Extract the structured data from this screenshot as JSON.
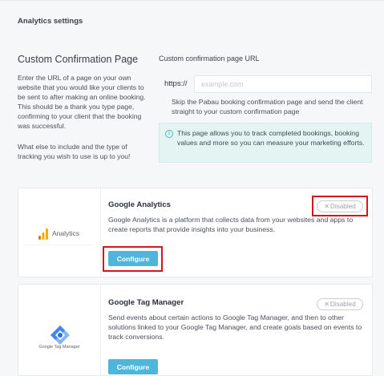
{
  "header": {
    "title": "Analytics settings"
  },
  "confirmation": {
    "heading": "Custom Confirmation Page",
    "description": "Enter the URL of a page on your own website that you would like your clients to be sent to after making an online booking. This should be a thank you type page, confirming to your client that the booking was successful.",
    "description_more": "What else to include and the type of tracking you wish to use is up to you!",
    "url_label": "Custom confirmation page URL",
    "url_prefix": "https://",
    "url_value": "",
    "url_placeholder": "example.com",
    "url_help": "Skip the Pabau booking confirmation page and send the client straight to your custom confirmation page",
    "info_text": "This page allows you to track completed bookings, booking values and more so you can measure your marketing efforts."
  },
  "integrations": [
    {
      "title": "Google Analytics",
      "description": "Google Analytics is a platform that collects data from your websites and apps to create reports that provide insights into your business.",
      "status": "Disabled",
      "configure_label": "Configure",
      "logo_text": "Analytics",
      "logo_icon": "google-analytics-icon"
    },
    {
      "title": "Google Tag Manager",
      "description": "Send events about certain actions to Google Tag Manager, and then to other solutions linked to your Google Tag Manager, and create goals based on events to track conversions.",
      "status": "Disabled",
      "configure_label": "Configure",
      "logo_text": "Google Tag Manager",
      "logo_icon": "google-tag-manager-icon"
    }
  ],
  "colors": {
    "accent": "#4eb7d9",
    "info_background": "#e4f4f3",
    "highlight_red": "#d2181c",
    "analytics_orange": "#f9ab00",
    "analytics_dark_orange": "#e37400",
    "gtm_blue": "#4285f4"
  }
}
